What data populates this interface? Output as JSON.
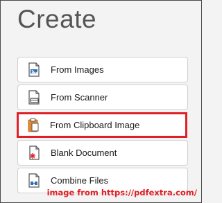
{
  "panel": {
    "title": "Create"
  },
  "items": [
    {
      "label": "From Images",
      "icon": "images-file-icon"
    },
    {
      "label": "From Scanner",
      "icon": "scanner-file-icon"
    },
    {
      "label": "From Clipboard Image",
      "icon": "clipboard-icon"
    },
    {
      "label": "Blank Document",
      "icon": "blank-document-icon"
    },
    {
      "label": "Combine Files",
      "icon": "combine-files-icon"
    }
  ],
  "caption": "image from https://pdfextra.com/",
  "colors": {
    "highlight": "#e01f26",
    "accent_blue": "#2f6fb6",
    "accent_orange": "#e3892f"
  }
}
